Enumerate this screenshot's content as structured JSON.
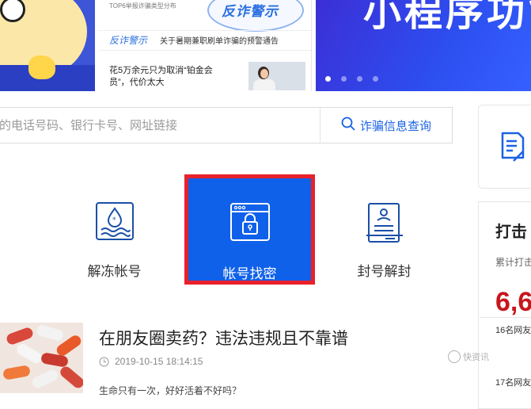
{
  "banner": {
    "news_subtitle": "TOP6举报诈骗类型分布",
    "stamp_text": "反诈警示",
    "tag": "反诈警示",
    "news_items": [
      "关于暑期兼职刷单诈骗的预警通告",
      "花5万余元只为取消“铂金会员”，代价太大"
    ],
    "hero_title": "小程序功能",
    "carousel_dots": 4
  },
  "search": {
    "placeholder": "的电话号码、银行卡号、网址链接",
    "button_label": "诈骗信息查询",
    "button_icon": "search-icon"
  },
  "services": [
    {
      "label": "号",
      "icon": "account-icon",
      "active": false
    },
    {
      "label": "解冻帐号",
      "icon": "unfreeze-icon",
      "active": false
    },
    {
      "label": "帐号找密",
      "icon": "lock-window-icon",
      "active": true
    },
    {
      "label": "封号解封",
      "icon": "document-icon",
      "active": false
    }
  ],
  "side": {
    "strike_title": "打击",
    "strike_subtitle": "累计打击",
    "strike_number": "6,6",
    "rows": [
      "16名网友",
      "17名网友"
    ]
  },
  "article": {
    "title": "在朋友圈卖药？违法违规且不靠谱",
    "time": "2019-10-15 18:14:15",
    "summary": "生命只有一次，好好活着不好吗？"
  },
  "watermark": "快资讯",
  "colors": {
    "brand_blue": "#1061ea",
    "highlight_red": "#e8212b",
    "number_red": "#c7161d"
  }
}
